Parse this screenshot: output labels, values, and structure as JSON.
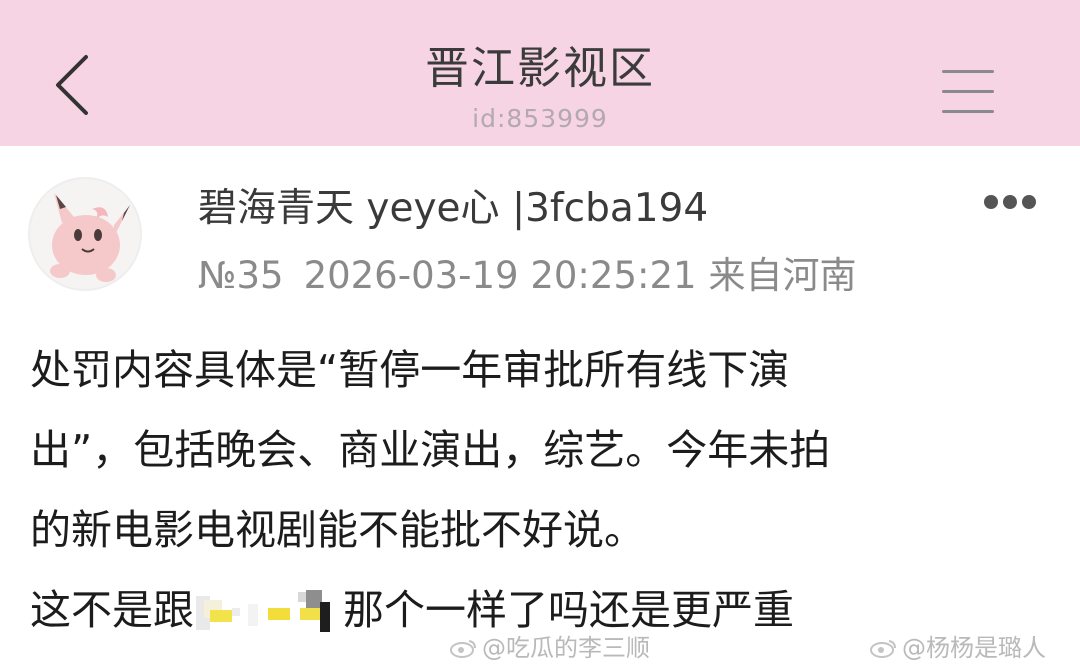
{
  "header": {
    "title": "晋江影视区",
    "board_id": "id:853999",
    "background_color": "#f7d4e4",
    "back_icon": "chevron-left-icon",
    "menu_icon": "hamburger-menu-icon"
  },
  "post": {
    "author": "碧海青天 yeye心",
    "author_hash": "|3fcba194",
    "floor": "№35",
    "timestamp": "2026-03-19 20:25:21",
    "location": "来自河南",
    "more_icon": "more-dots-icon",
    "avatar_icon": "clefairy-avatar-icon",
    "content": {
      "line1": "处罚内容具体是“暂停一年审批所有线下演",
      "line2": "出”，包括晚会、商业演出，综艺。今年未拍",
      "line3": "的新电影电视剧能不能批不好说。",
      "line4_before": "这不是跟",
      "line4_after": "那个一样了吗还是更严重"
    }
  },
  "watermarks": {
    "left": "@吃瓜的李三顺",
    "right": "@杨杨是璐人"
  }
}
